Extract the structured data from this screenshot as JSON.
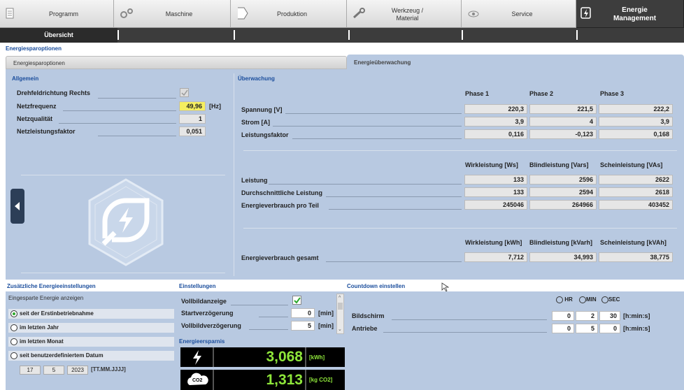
{
  "nav": {
    "tabs": [
      {
        "label": "Programm",
        "icon": "document-icon"
      },
      {
        "label": "Maschine",
        "icon": "gears-icon"
      },
      {
        "label": "Produktion",
        "icon": "arrow-tab-icon"
      },
      {
        "label": "Werkzeug /",
        "label2": "Material",
        "icon": "wrench-icon"
      },
      {
        "label": "Service",
        "icon": "eye-icon"
      },
      {
        "label": "Energie",
        "label2": "Management",
        "icon": "energy-icon",
        "active": true
      }
    ],
    "subtab": "Übersicht"
  },
  "page_title": "Energiesparoptionen",
  "tabs": {
    "left": "Energiesparoptionen",
    "right": "Energieüberwachung"
  },
  "allgemein": {
    "title": "Allgemein",
    "rows": [
      {
        "label": "Drehfeldrichtung Rechts"
      },
      {
        "label": "Netzfrequenz",
        "value": "49,96",
        "unit": "[Hz]"
      },
      {
        "label": "Netzqualität",
        "value": "1"
      },
      {
        "label": "Netzleistungsfaktor",
        "value": "0,051"
      }
    ]
  },
  "ueberwachung": {
    "title": "Überwachung",
    "phase_headers": [
      "Phase 1",
      "Phase 2",
      "Phase 3"
    ],
    "phase_rows": [
      {
        "label": "Spannung [V]",
        "values": [
          "220,3",
          "221,5",
          "222,2"
        ]
      },
      {
        "label": "Strom [A]",
        "values": [
          "3,9",
          "4",
          "3,9"
        ]
      },
      {
        "label": "Leistungsfaktor",
        "values": [
          "0,116",
          "-0,123",
          "0,168"
        ]
      }
    ],
    "power_headers": [
      "Wirkleistung [Ws]",
      "Blindleistung [Vars]",
      "Scheinleistung [VAs]"
    ],
    "power_rows": [
      {
        "label": "Leistung",
        "values": [
          "133",
          "2596",
          "2622"
        ]
      },
      {
        "label": "Durchschnittliche Leistung",
        "values": [
          "133",
          "2594",
          "2618"
        ]
      },
      {
        "label": "Energieverbrauch pro Teil",
        "values": [
          "245046",
          "264966",
          "403452"
        ]
      }
    ],
    "total_headers": [
      "Wirkleistung [kWh]",
      "Blindleistung [kVarh]",
      "Scheinleistung [kVAh]"
    ],
    "total_rows": [
      {
        "label": "Energieverbrauch gesamt",
        "values": [
          "7,712",
          "34,993",
          "38,775"
        ]
      }
    ]
  },
  "zusatz": {
    "title": "Zusätzliche Energieeinstellungen",
    "subtitle": "Eingesparte Energie anzeigen",
    "options": [
      "seit der Erstinbetriebnahme",
      "im letzten Jahr",
      "im letzten Monat",
      "seit benutzerdefiniertem Datum"
    ],
    "selected": 0,
    "date": {
      "day": "17",
      "month": "5",
      "year": "2023",
      "format": "[TT.MM.JJJJ]"
    }
  },
  "einstellungen": {
    "title": "Einstellungen",
    "rows": [
      {
        "label": "Vollbildanzeige"
      },
      {
        "label": "Startverzögerung",
        "value": "0",
        "unit": "[min]"
      },
      {
        "label": "Vollbildverzögerung",
        "value": "5",
        "unit": "[min]"
      }
    ]
  },
  "ersparnis": {
    "title": "Energieersparnis",
    "rows": [
      {
        "value": "3,068",
        "unit": "[kWh]",
        "icon": "lightning-icon"
      },
      {
        "value": "1,313",
        "unit": "[kg CO2]",
        "icon": "co2-cloud-icon",
        "icon_text": "CO2"
      }
    ]
  },
  "countdown": {
    "title": "Countdown einstellen",
    "headers": [
      "HR",
      "MIN",
      "SEC"
    ],
    "rows": [
      {
        "label": "Bildschirm",
        "values": [
          "0",
          "2",
          "30"
        ],
        "unit": "[h:min:s]"
      },
      {
        "label": "Antriebe",
        "values": [
          "0",
          "5",
          "0"
        ],
        "unit": "[h:min:s]"
      }
    ]
  },
  "colors": {
    "panel": "#b8c9e1",
    "highlight": "#f5ee60",
    "accent_green": "#8ee63a",
    "title_blue": "#1a4d9c"
  }
}
